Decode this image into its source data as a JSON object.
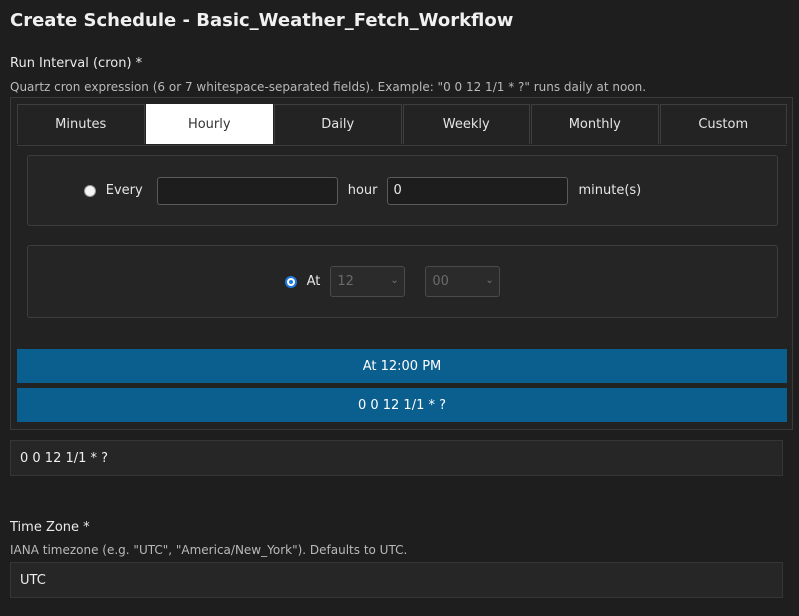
{
  "title": "Create Schedule - Basic_Weather_Fetch_Workflow",
  "run_interval": {
    "label": "Run Interval (cron) *",
    "help": "Quartz cron expression (6 or 7 whitespace-separated fields). Example: \"0 0 12 1/1 * ?\" runs daily at noon.",
    "tabs": [
      {
        "label": "Minutes"
      },
      {
        "label": "Hourly"
      },
      {
        "label": "Daily"
      },
      {
        "label": "Weekly"
      },
      {
        "label": "Monthly"
      },
      {
        "label": "Custom"
      }
    ],
    "active_tab": "Hourly",
    "every_option": {
      "label": "Every",
      "hour_value": "",
      "hour_label": "hour",
      "minute_value": "0",
      "minute_label": "minute(s)",
      "selected": false
    },
    "at_option": {
      "label": "At",
      "hour_selected": "12",
      "minute_selected": "00",
      "selected": true
    },
    "description_bar": "At 12:00 PM",
    "expression_bar": "0 0 12 1/1 * ?",
    "cron_value": "0 0 12 1/1 * ?"
  },
  "time_zone": {
    "label": "Time Zone *",
    "help": "IANA timezone (e.g. \"UTC\", \"America/New_York\"). Defaults to UTC.",
    "value": "UTC"
  },
  "colors": {
    "background": "#1e1e1e",
    "accent_bar": "#0a5f8e",
    "radio_selected": "#1f7ae0",
    "active_tab": "#ffffff"
  }
}
